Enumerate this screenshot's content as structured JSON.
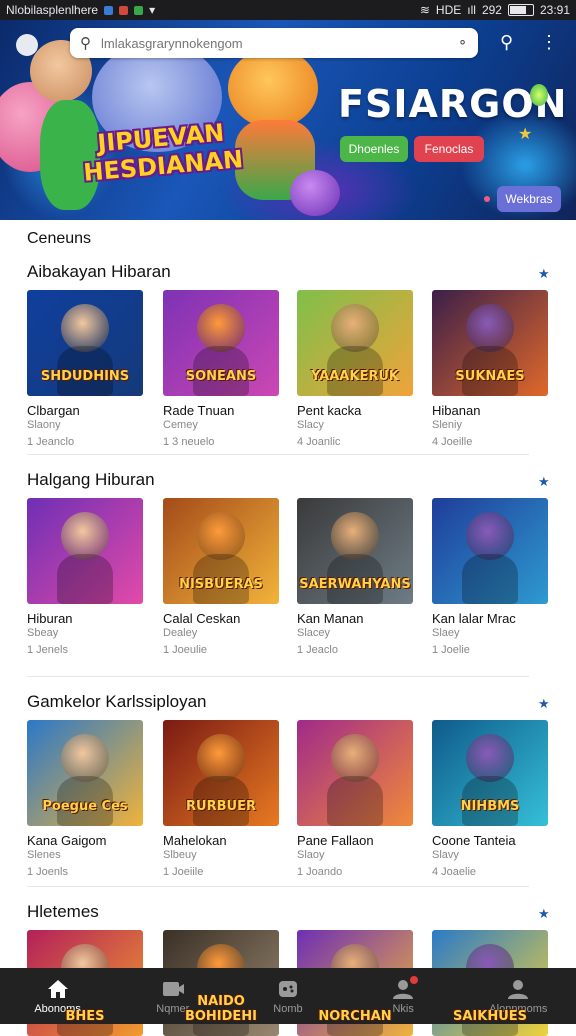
{
  "status_bar": {
    "left_text": "Nlobilasplenlhere",
    "right_text": "HDE",
    "signal": "292",
    "time": "23:91"
  },
  "hero": {
    "search_placeholder": "lmlakasgrarynnokengom",
    "title": "FSIARGON",
    "logo_line1": "JIPUEVAN",
    "logo_line2": "HESDIANAN",
    "button_green": "Dhoenles",
    "button_red": "Fenoclas",
    "button_purple": "Wekbras"
  },
  "category_label": "Ceneuns",
  "sections": [
    {
      "title": "Aibakayan Hibaran",
      "cards": [
        {
          "thumb_text": "SHDUDHINS",
          "name": "Clbargan",
          "sub": "Slaony",
          "meta": "1 Jeanclo",
          "bg": [
            "#0f3f9e",
            "#153a7a"
          ]
        },
        {
          "thumb_text": "SONEANS",
          "name": "Rade Tnuan",
          "sub": "Cemey",
          "meta": "1 3 neuelo",
          "bg": [
            "#7d32b5",
            "#cc47b3"
          ]
        },
        {
          "thumb_text": "YAAAKERUK",
          "name": "Pent kacka",
          "sub": "Slacy",
          "meta": "4 Joanlic",
          "bg": [
            "#7fbf4a",
            "#f0a33a"
          ]
        },
        {
          "thumb_text": "SUKNAES",
          "name": "Hibanan",
          "sub": "Sleniy",
          "meta": "4 Joeille",
          "bg": [
            "#3b1f4a",
            "#e0682a"
          ]
        }
      ]
    },
    {
      "title": "Halgang Hiburan",
      "cards": [
        {
          "thumb_text": "",
          "name": "Hiburan",
          "sub": "Sbeay",
          "meta": "1 Jenels",
          "bg": [
            "#6e2fb5",
            "#e34aa8"
          ]
        },
        {
          "thumb_text": "NISBUERAS",
          "name": "Calal Ceskan",
          "sub": "Dealey",
          "meta": "1 Joeulie",
          "bg": [
            "#a44a1a",
            "#f2b43a"
          ]
        },
        {
          "thumb_text": "SAERWAHYANS",
          "name": "Kan Manan",
          "sub": "Slacey",
          "meta": "1 Jeaclo",
          "bg": [
            "#3a3a3a",
            "#6e7c86"
          ]
        },
        {
          "thumb_text": "",
          "name": "Kan lalar Mrac",
          "sub": "Slaey",
          "meta": "1 Joelie",
          "bg": [
            "#1f3d9a",
            "#2e9ad0"
          ]
        }
      ]
    },
    {
      "title": "Gamkelor Karlssiployan",
      "cards": [
        {
          "thumb_text": "Poegue Ces",
          "name": "Kana Gaigom",
          "sub": "Slenes",
          "meta": "1 Joenls",
          "bg": [
            "#2a78c9",
            "#f0b33a"
          ]
        },
        {
          "thumb_text": "RURBUER",
          "name": "Mahelokan",
          "sub": "Slbeuy",
          "meta": "1 Joeiile",
          "bg": [
            "#7a1a14",
            "#e87a22"
          ]
        },
        {
          "thumb_text": "",
          "name": "Pane Fallaon",
          "sub": "Slaoy",
          "meta": "1 Joando",
          "bg": [
            "#a02a8a",
            "#f08a3a"
          ]
        },
        {
          "thumb_text": "NIHBMS",
          "name": "Coone Tanteia",
          "sub": "Slavy",
          "meta": "4 Joaelie",
          "bg": [
            "#0f5a8a",
            "#35c0d8"
          ]
        }
      ]
    },
    {
      "title": "Hletemes",
      "cards": [
        {
          "thumb_text": "BHES",
          "name": "",
          "sub": "",
          "meta": "",
          "bg": [
            "#b3205a",
            "#f29b2e"
          ]
        },
        {
          "thumb_text": "NAIDO BOHIDEHI",
          "name": "",
          "sub": "",
          "meta": "",
          "bg": [
            "#3a3026",
            "#9a8870"
          ]
        },
        {
          "thumb_text": "NORCHAN",
          "name": "",
          "sub": "",
          "meta": "",
          "bg": [
            "#6e2fb5",
            "#f0b33a"
          ]
        },
        {
          "thumb_text": "SAIKHUES",
          "name": "",
          "sub": "",
          "meta": "",
          "bg": [
            "#2a7ac8",
            "#f0d23a"
          ]
        }
      ]
    }
  ],
  "bottom_nav": [
    {
      "label": "Abonoms",
      "icon": "home-icon"
    },
    {
      "label": "Nqmer",
      "icon": "video-icon"
    },
    {
      "label": "Nomb",
      "icon": "gamepad-icon"
    },
    {
      "label": "Nkis",
      "icon": "person-notification-icon"
    },
    {
      "label": "Alonnmoms",
      "icon": "account-icon"
    }
  ],
  "colors": {
    "accent": "#1f5aa6",
    "nav_bg": "#222222",
    "status_bg": "#1c1c1e"
  }
}
